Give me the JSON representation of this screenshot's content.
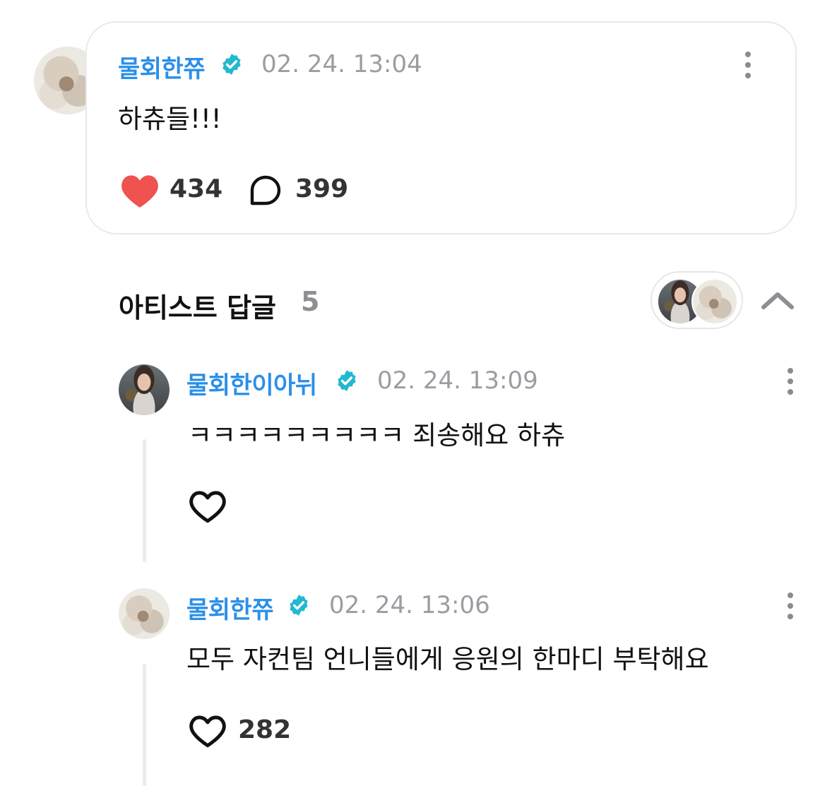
{
  "post": {
    "author": "물회한쮸",
    "timestamp": "02. 24. 13:04",
    "text": "하츄들!!!",
    "likes": "434",
    "comments": "399"
  },
  "replies_section": {
    "title": "아티스트 답글",
    "count": "5"
  },
  "replies": [
    {
      "author": "물회한이아뉘",
      "timestamp": "02. 24. 13:09",
      "text": "ㅋㅋㅋㅋㅋㅋㅋㅋㅋ 죄송해요 하츄",
      "likes": ""
    },
    {
      "author": "물회한쮸",
      "timestamp": "02. 24. 13:06",
      "text": "모두 자컨팀 언니들에게 응원의 한마디 부탁해요",
      "likes": "282"
    }
  ],
  "colors": {
    "name_blue": "#2b8fe8",
    "verified_teal": "#22b8cf",
    "heart_red": "#f0524f",
    "timestamp_gray": "#9c9ca3"
  },
  "icons": [
    "verified-badge-icon",
    "more-options-icon",
    "heart-filled-icon",
    "comment-bubble-icon",
    "heart-outline-icon",
    "chevron-up-icon"
  ]
}
